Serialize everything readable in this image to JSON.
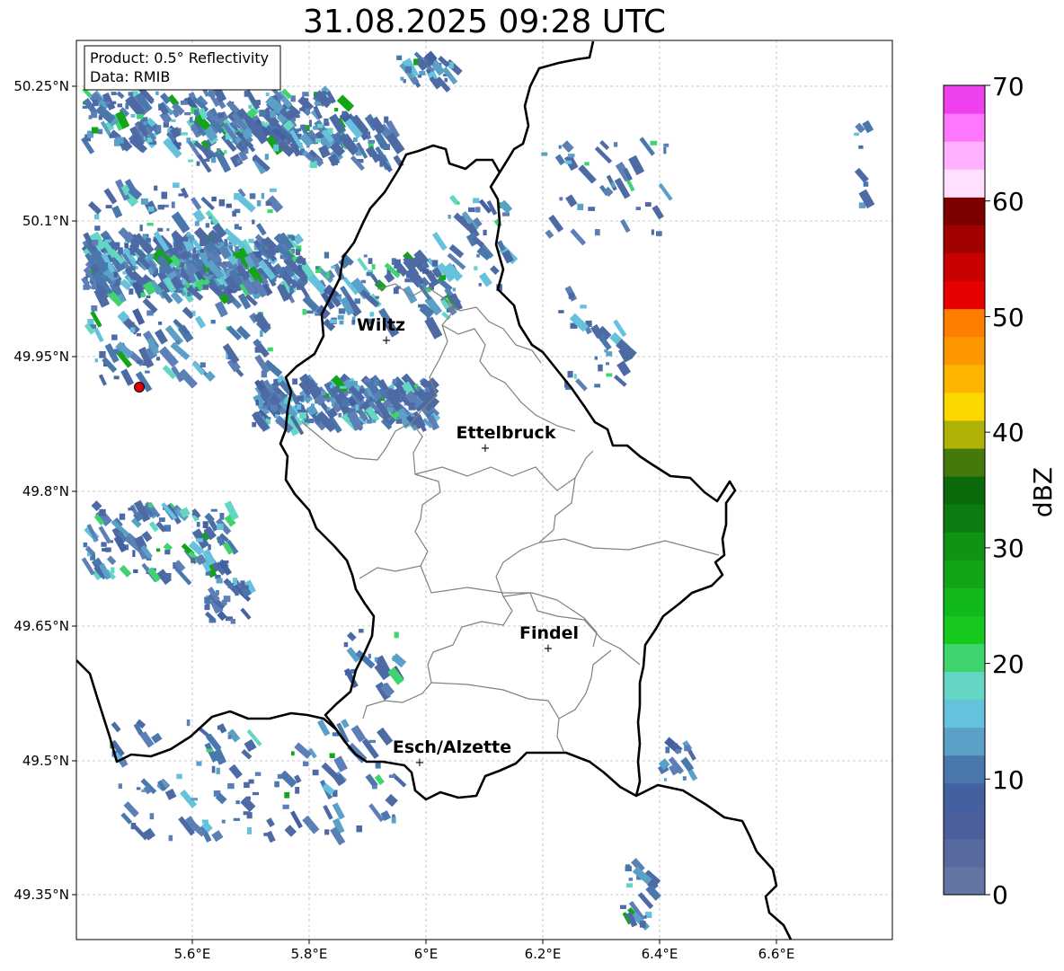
{
  "title": "31.08.2025 09:28 UTC",
  "info_box": {
    "product": "Product: 0.5° Reflectivity",
    "data": "Data: RMIB"
  },
  "lat_labels": [
    "50.25°N",
    "50.1°N",
    "49.95°N",
    "49.8°N",
    "49.65°N",
    "49.5°N",
    "49.35°N"
  ],
  "lon_labels": [
    "5.6°E",
    "5.8°E",
    "6°E",
    "6.2°E",
    "6.4°E",
    "6.6°E"
  ],
  "cities": [
    {
      "name": "Wiltz"
    },
    {
      "name": "Ettelbruck"
    },
    {
      "name": "Findel"
    },
    {
      "name": "Esch/Alzette"
    }
  ],
  "colorbar": {
    "label": "dBZ",
    "ticks": [
      "0",
      "10",
      "20",
      "30",
      "40",
      "50",
      "60",
      "70"
    ],
    "colors": [
      "#6475a4",
      "#57699e",
      "#4a5f9c",
      "#4360a1",
      "#4a78ad",
      "#5ba0c6",
      "#66c2dc",
      "#63d7c4",
      "#3fd46d",
      "#18c91d",
      "#12b91a",
      "#13a517",
      "#109313",
      "#0c7c10",
      "#0b6a0b",
      "#447a0b",
      "#afb107",
      "#fdd700",
      "#fdb500",
      "#fd9700",
      "#fd7e00",
      "#e60000",
      "#c80000",
      "#a30000",
      "#7c0000",
      "#ffe0ff",
      "#ffb0ff",
      "#ff77ff",
      "#ee40ee"
    ]
  },
  "colors": {
    "border": "#000000",
    "canton_line": "#808080",
    "grid": "#bbbbbb",
    "radar_site": "#e00000"
  }
}
